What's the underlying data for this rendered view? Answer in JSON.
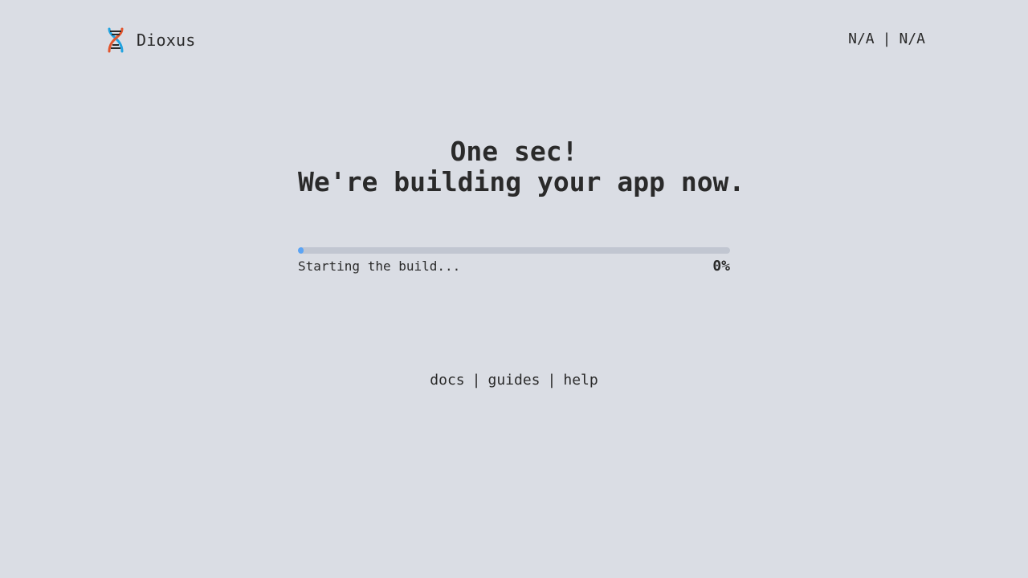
{
  "header": {
    "brand": "Dioxus",
    "logo_icon": "dna-helix-icon",
    "version_left": "N/A",
    "version_separator": "|",
    "version_right": "N/A"
  },
  "main": {
    "title_line1": "One sec!",
    "title_line2": "We're building your app now."
  },
  "progress": {
    "status": "Starting the build...",
    "percent_label": "0%",
    "fraction": 0.0
  },
  "footer": {
    "links": [
      "docs",
      "guides",
      "help"
    ],
    "separator": "|"
  },
  "colors": {
    "background": "#dadde4",
    "text": "#2a2a2a",
    "progress_fill": "#5ba4f5",
    "progress_track": "#c1c6d1",
    "logo_blue": "#21a3e0",
    "logo_orange": "#e2552d"
  }
}
